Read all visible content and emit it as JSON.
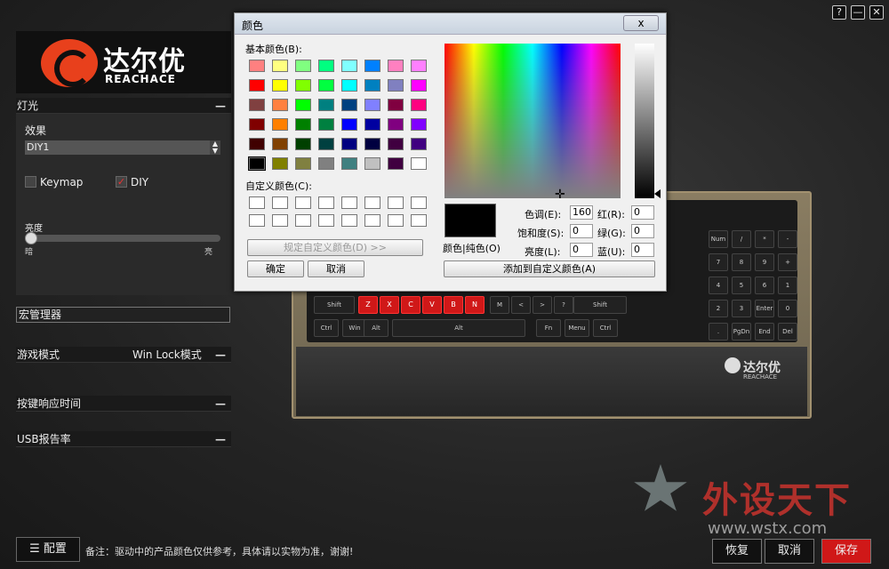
{
  "window_controls": {
    "help": "?",
    "minimize": "—",
    "close": "✕"
  },
  "brand": {
    "name_cn": "达尔优",
    "name_en": "REACHACE"
  },
  "lighting": {
    "section_title": "灯光",
    "effect_label": "效果",
    "effect_value": "DIY1",
    "keymap_label": "Keymap",
    "keymap_checked": false,
    "diy_label": "DIY",
    "diy_checked": true,
    "brightness_label": "亮度",
    "brightness_min_label": "暗",
    "brightness_max_label": "亮",
    "brightness_level": 0
  },
  "macro_manager": "宏管理器",
  "game_mode": {
    "label": "游戏模式",
    "value": "Win Lock模式"
  },
  "response_time": "按键响应时间",
  "usb_rate": "USB报告率",
  "collapse_symbol": "—",
  "color_dialog": {
    "title": "颜色",
    "close": "x",
    "basic_colors_label": "基本颜色(B):",
    "basic_colors": [
      "#ff8080",
      "#ffff80",
      "#80ff80",
      "#00ff80",
      "#80ffff",
      "#0080ff",
      "#ff80c0",
      "#ff80ff",
      "#ff0000",
      "#ffff00",
      "#80ff00",
      "#00ff40",
      "#00ffff",
      "#0080c0",
      "#8080c0",
      "#ff00ff",
      "#804040",
      "#ff8040",
      "#00ff00",
      "#008080",
      "#004080",
      "#8080ff",
      "#800040",
      "#ff0080",
      "#800000",
      "#ff8000",
      "#008000",
      "#008040",
      "#0000ff",
      "#0000a0",
      "#800080",
      "#8000ff",
      "#400000",
      "#804000",
      "#004000",
      "#004040",
      "#000080",
      "#000040",
      "#400040",
      "#400080",
      "#000000",
      "#808000",
      "#808040",
      "#808080",
      "#408080",
      "#c0c0c0",
      "#400040",
      "#ffffff"
    ],
    "custom_colors_label": "自定义颜色(C):",
    "define_custom_button": "规定自定义颜色(D) >>",
    "ok_button": "确定",
    "cancel_button": "取消",
    "color_solid_label": "颜色|纯色(O)",
    "hue_label": "色调(E):",
    "hue_value": "160",
    "sat_label": "饱和度(S):",
    "sat_value": "0",
    "lum_label": "亮度(L):",
    "lum_value": "0",
    "red_label": "红(R):",
    "red_value": "0",
    "green_label": "绿(G):",
    "green_value": "0",
    "blue_label": "蓝(U):",
    "blue_value": "0",
    "add_custom_button": "添加到自定义颜色(A)",
    "current_color": "#000000"
  },
  "keyboard": {
    "brand_cn": "达尔优",
    "brand_en": "REACHACE",
    "red_keys": [
      "Z",
      "X",
      "C",
      "V",
      "B",
      "N"
    ],
    "other_keys": [
      "Ctrl",
      "Win",
      "Alt",
      "Alt",
      "Fn",
      "Menu",
      "Ctrl",
      "M",
      "<",
      ">",
      "?",
      "Shift",
      "Shift",
      "Num",
      "/",
      "*",
      "-",
      "7",
      "8",
      "9",
      "+",
      "4",
      "5",
      "6",
      "1",
      "2",
      "3",
      "Enter",
      "0",
      ".",
      "PgDn",
      "End",
      "Del"
    ]
  },
  "footer": {
    "config_button": "配置",
    "note": "备注：驱动中的产品颜色仅供参考，具体请以实物为准，谢谢!",
    "restore_button": "恢复",
    "cancel_button": "取消",
    "save_button": "保存",
    "save_color": "#d01818"
  },
  "watermark": {
    "text": "外设天下",
    "url": "www.wstx.com"
  }
}
